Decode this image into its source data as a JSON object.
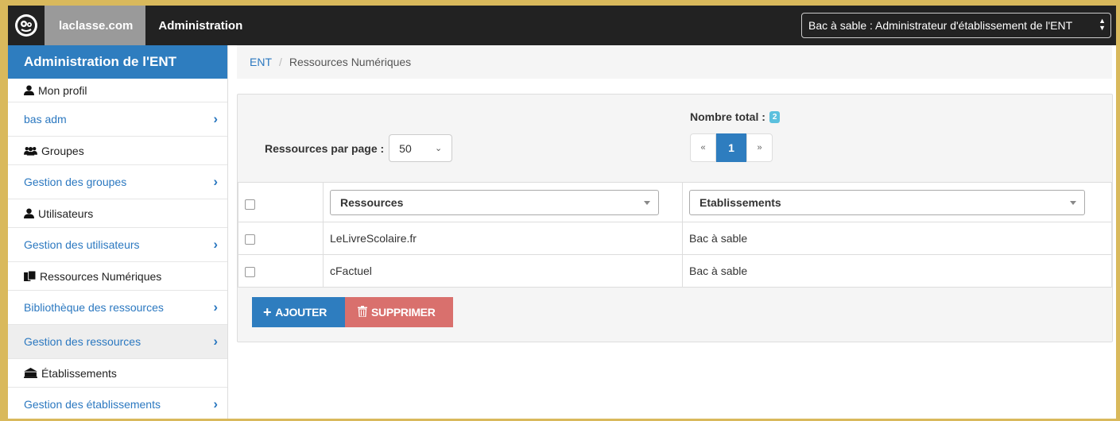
{
  "navbar": {
    "brand": "laclasse.com",
    "title": "Administration",
    "profile_select": "Bac à sable : Administrateur d'établissement de l'ENT"
  },
  "sidebar": {
    "title": "Administration de l'ENT",
    "items": [
      {
        "label": "Mon profil",
        "type": "label",
        "icon": "user-icon"
      },
      {
        "label": "bas adm",
        "type": "link"
      },
      {
        "label": "Groupes",
        "type": "label",
        "icon": "group-icon"
      },
      {
        "label": "Gestion des groupes",
        "type": "link"
      },
      {
        "label": "Utilisateurs",
        "type": "label",
        "icon": "user-icon"
      },
      {
        "label": "Gestion des utilisateurs",
        "type": "link"
      },
      {
        "label": "Ressources Numériques",
        "type": "label",
        "icon": "files-icon"
      },
      {
        "label": "Bibliothèque des ressources",
        "type": "link"
      },
      {
        "label": "Gestion des ressources",
        "type": "link",
        "active": true
      },
      {
        "label": "Établissements",
        "type": "label",
        "icon": "school-icon"
      },
      {
        "label": "Gestion des établissements",
        "type": "link"
      }
    ]
  },
  "breadcrumb": {
    "root": "ENT",
    "separator": "/",
    "current": "Ressources Numériques"
  },
  "panel": {
    "per_page_label": "Ressources par page :",
    "per_page_value": "50",
    "total_label": "Nombre total :",
    "total_count": "2",
    "pager": {
      "prev": "«",
      "current": "1",
      "next": "»"
    }
  },
  "table": {
    "headers": [
      "Ressources",
      "Etablissements"
    ],
    "rows": [
      {
        "resource": "LeLivreScolaire.fr",
        "school": "Bac à sable"
      },
      {
        "resource": "cFactuel",
        "school": "Bac à sable"
      }
    ]
  },
  "actions": {
    "add_label": "AJOUTER",
    "delete_label": "SUPPRIMER"
  },
  "colors": {
    "accent": "#2e7dbf",
    "danger": "#d9706d",
    "navbar": "#222222",
    "outer_border": "#d9b95c"
  }
}
